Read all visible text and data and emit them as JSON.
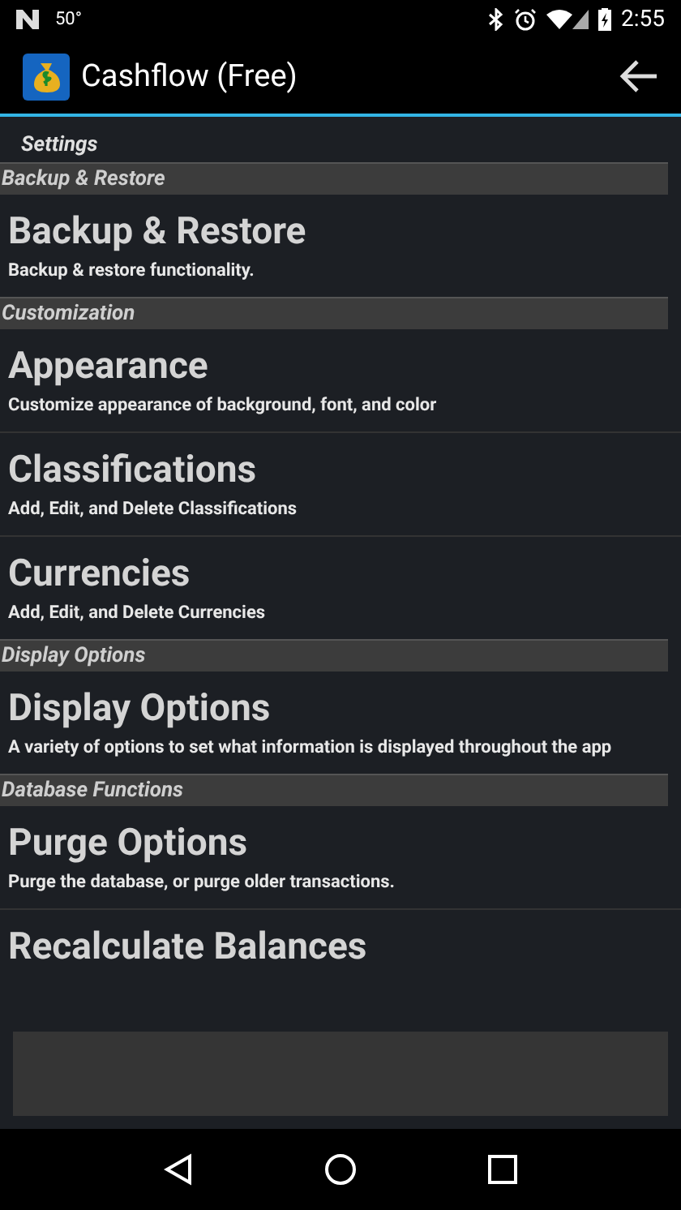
{
  "status_bar": {
    "temperature": "50°",
    "time": "2:55"
  },
  "app_bar": {
    "title": "Cashflow (Free)"
  },
  "screen_title": "Settings",
  "sections": [
    {
      "header": "Backup & Restore",
      "items": [
        {
          "title": "Backup & Restore",
          "subtitle": "Backup & restore functionality."
        }
      ]
    },
    {
      "header": "Customization",
      "items": [
        {
          "title": "Appearance",
          "subtitle": "Customize appearance of background, font, and color"
        },
        {
          "title": "Classifications",
          "subtitle": "Add, Edit, and Delete Classifications"
        },
        {
          "title": "Currencies",
          "subtitle": "Add, Edit, and Delete Currencies"
        }
      ]
    },
    {
      "header": "Display Options",
      "items": [
        {
          "title": "Display Options",
          "subtitle": "A variety of options to set what information is displayed throughout the app"
        }
      ]
    },
    {
      "header": "Database Functions",
      "items": [
        {
          "title": "Purge Options",
          "subtitle": "Purge the database, or purge older transactions."
        },
        {
          "title": "Recalculate Balances"
        }
      ]
    }
  ]
}
